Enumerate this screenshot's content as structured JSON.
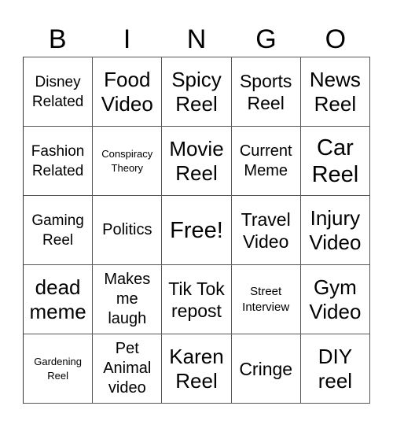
{
  "header": {
    "letters": [
      "B",
      "I",
      "N",
      "G",
      "O"
    ]
  },
  "board": {
    "rows": [
      [
        "Disney\nRelated",
        "Food\nVideo",
        "Spicy\nReel",
        "Sports\nReel",
        "News\nReel"
      ],
      [
        "Fashion\nRelated",
        "Conspiracy\nTheory",
        "Movie\nReel",
        "Current\nMeme",
        "Car\nReel"
      ],
      [
        "Gaming\nReel",
        "Politics",
        "Free!",
        "Travel\nVideo",
        "Injury\nVideo"
      ],
      [
        "dead\nmeme",
        "Makes\nme\nlaugh",
        "Tik Tok\nrepost",
        "Street\nInterview",
        "Gym\nVideo"
      ],
      [
        "Gardening\nReel",
        "Pet\nAnimal\nvideo",
        "Karen\nReel",
        "Cringe",
        "DIY\nreel"
      ]
    ],
    "free_space": "Free!"
  }
}
